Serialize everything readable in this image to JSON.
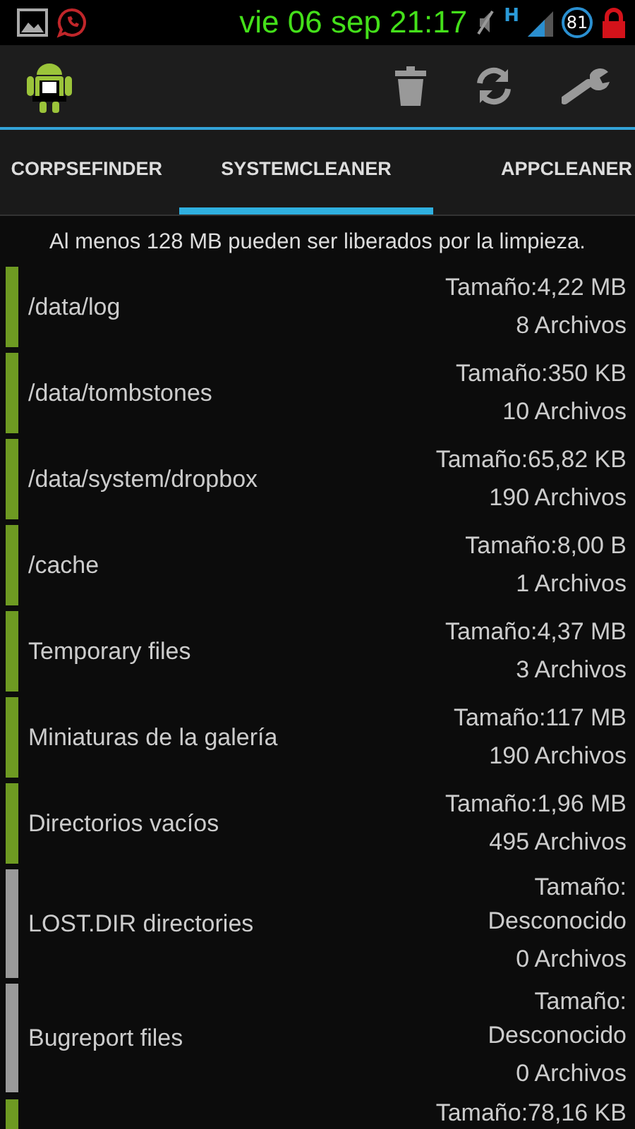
{
  "status_bar": {
    "time": "vie 06 sep 21:17",
    "network": "H",
    "battery": "81"
  },
  "tabs": [
    {
      "label": "CORPSEFINDER",
      "selected": false
    },
    {
      "label": "SYSTEMCLEANER",
      "selected": true
    },
    {
      "label": "APPCLEANER",
      "selected": false
    }
  ],
  "summary": "Al menos 128 MB pueden ser liberados por la limpieza.",
  "items": [
    {
      "name": "/data/log",
      "kind": "known",
      "size_label": "Tamaño:",
      "size_value": "4,22 MB",
      "count": "8 Archivos",
      "color": "#6e9a22"
    },
    {
      "name": "/data/tombstones",
      "kind": "known",
      "size_label": "Tamaño:",
      "size_value": "350 KB",
      "count": "10 Archivos",
      "color": "#6e9a22"
    },
    {
      "name": "/data/system/dropbox",
      "kind": "known",
      "size_label": "Tamaño:",
      "size_value": "65,82 KB",
      "count": "190 Archivos",
      "color": "#6e9a22"
    },
    {
      "name": "/cache",
      "kind": "known",
      "size_label": "Tamaño:",
      "size_value": "8,00 B",
      "count": "1 Archivos",
      "color": "#6e9a22"
    },
    {
      "name": "Temporary files",
      "kind": "known",
      "size_label": "Tamaño:",
      "size_value": "4,37 MB",
      "count": "3 Archivos",
      "color": "#6e9a22"
    },
    {
      "name": "Miniaturas de la galería",
      "kind": "known",
      "size_label": "Tamaño:",
      "size_value": "117 MB",
      "count": "190 Archivos",
      "color": "#6e9a22"
    },
    {
      "name": "Directorios vacíos",
      "kind": "known",
      "size_label": "Tamaño:",
      "size_value": "1,96 MB",
      "count": "495 Archivos",
      "color": "#6e9a22"
    },
    {
      "name": "LOST.DIR directories",
      "kind": "unknown",
      "size_label": "Tamaño:",
      "size_value": "Desconocido",
      "count": "0 Archivos",
      "color": "#9a9a9a"
    },
    {
      "name": "Bugreport files",
      "kind": "unknown",
      "size_label": "Tamaño:",
      "size_value": "Desconocido",
      "count": "0 Archivos",
      "color": "#9a9a9a"
    },
    {
      "kind": "known",
      "size_label": "Tamaño:",
      "size_value": "78,16 KB",
      "color": "#6e9a22"
    }
  ]
}
